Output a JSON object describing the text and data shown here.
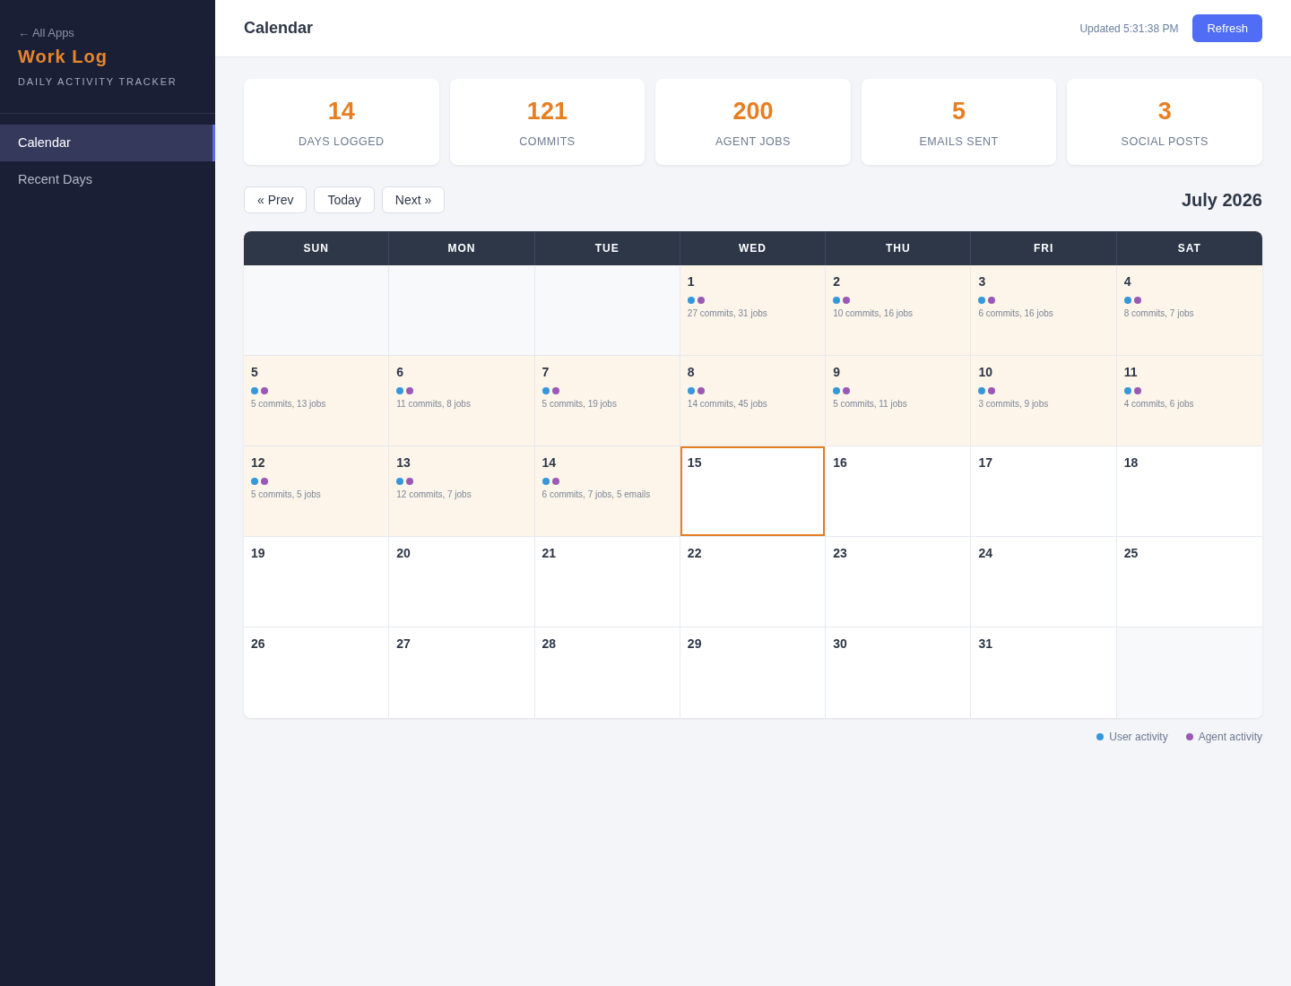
{
  "sidebar": {
    "back_link": "← All Apps",
    "title": "Work Log",
    "subtitle": "DAILY ACTIVITY TRACKER",
    "items": [
      {
        "label": "Calendar",
        "selected": true
      },
      {
        "label": "Recent Days",
        "selected": false
      }
    ]
  },
  "header": {
    "title": "Calendar",
    "updated": "Updated 5:31:38 PM",
    "button": "Refresh"
  },
  "stats": [
    {
      "value": "14",
      "label": "DAYS LOGGED"
    },
    {
      "value": "121",
      "label": "COMMITS"
    },
    {
      "value": "200",
      "label": "AGENT JOBS"
    },
    {
      "value": "5",
      "label": "EMAILS SENT"
    },
    {
      "value": "3",
      "label": "SOCIAL POSTS"
    }
  ],
  "calendar_nav": {
    "buttons": [
      "« Prev",
      "Today",
      "Next »"
    ],
    "month": "July 2026"
  },
  "calendar": {
    "weekdays": [
      "SUN",
      "MON",
      "TUE",
      "WED",
      "THU",
      "FRI",
      "SAT"
    ],
    "cells": [
      {
        "kind": "blank"
      },
      {
        "kind": "blank"
      },
      {
        "kind": "blank"
      },
      {
        "kind": "day",
        "day": "1",
        "logged": true,
        "today": false,
        "dots": [
          {
            "color": "#3498db"
          },
          {
            "color": "#9b59b6"
          }
        ],
        "summary": "27 commits, 31 jobs"
      },
      {
        "kind": "day",
        "day": "2",
        "logged": true,
        "today": false,
        "dots": [
          {
            "color": "#3498db"
          },
          {
            "color": "#9b59b6"
          }
        ],
        "summary": "10 commits, 16 jobs"
      },
      {
        "kind": "day",
        "day": "3",
        "logged": true,
        "today": false,
        "dots": [
          {
            "color": "#3498db"
          },
          {
            "color": "#9b59b6"
          }
        ],
        "summary": "6 commits, 16 jobs"
      },
      {
        "kind": "day",
        "day": "4",
        "logged": true,
        "today": false,
        "dots": [
          {
            "color": "#3498db"
          },
          {
            "color": "#9b59b6"
          }
        ],
        "summary": "8 commits, 7 jobs"
      },
      {
        "kind": "day",
        "day": "5",
        "logged": true,
        "today": false,
        "dots": [
          {
            "color": "#3498db"
          },
          {
            "color": "#9b59b6"
          }
        ],
        "summary": "5 commits, 13 jobs"
      },
      {
        "kind": "day",
        "day": "6",
        "logged": true,
        "today": false,
        "dots": [
          {
            "color": "#3498db"
          },
          {
            "color": "#9b59b6"
          }
        ],
        "summary": "11 commits, 8 jobs"
      },
      {
        "kind": "day",
        "day": "7",
        "logged": true,
        "today": false,
        "dots": [
          {
            "color": "#3498db"
          },
          {
            "color": "#9b59b6"
          }
        ],
        "summary": "5 commits, 19 jobs"
      },
      {
        "kind": "day",
        "day": "8",
        "logged": true,
        "today": false,
        "dots": [
          {
            "color": "#3498db"
          },
          {
            "color": "#9b59b6"
          }
        ],
        "summary": "14 commits, 45 jobs"
      },
      {
        "kind": "day",
        "day": "9",
        "logged": true,
        "today": false,
        "dots": [
          {
            "color": "#3498db"
          },
          {
            "color": "#9b59b6"
          }
        ],
        "summary": "5 commits, 11 jobs"
      },
      {
        "kind": "day",
        "day": "10",
        "logged": true,
        "today": false,
        "dots": [
          {
            "color": "#3498db"
          },
          {
            "color": "#9b59b6"
          }
        ],
        "summary": "3 commits, 9 jobs"
      },
      {
        "kind": "day",
        "day": "11",
        "logged": true,
        "today": false,
        "dots": [
          {
            "color": "#3498db"
          },
          {
            "color": "#9b59b6"
          }
        ],
        "summary": "4 commits, 6 jobs"
      },
      {
        "kind": "day",
        "day": "12",
        "logged": true,
        "today": false,
        "dots": [
          {
            "color": "#3498db"
          },
          {
            "color": "#9b59b6"
          }
        ],
        "summary": "5 commits, 5 jobs"
      },
      {
        "kind": "day",
        "day": "13",
        "logged": true,
        "today": false,
        "dots": [
          {
            "color": "#3498db"
          },
          {
            "color": "#9b59b6"
          }
        ],
        "summary": "12 commits, 7 jobs"
      },
      {
        "kind": "day",
        "day": "14",
        "logged": true,
        "today": false,
        "dots": [
          {
            "color": "#3498db"
          },
          {
            "color": "#9b59b6"
          }
        ],
        "summary": "6 commits, 7 jobs, 5 emails"
      },
      {
        "kind": "day",
        "day": "15",
        "logged": false,
        "today": true
      },
      {
        "kind": "day",
        "day": "16",
        "logged": false,
        "today": false
      },
      {
        "kind": "day",
        "day": "17",
        "logged": false,
        "today": false
      },
      {
        "kind": "day",
        "day": "18",
        "logged": false,
        "today": false
      },
      {
        "kind": "day",
        "day": "19",
        "logged": false,
        "today": false
      },
      {
        "kind": "day",
        "day": "20",
        "logged": false,
        "today": false
      },
      {
        "kind": "day",
        "day": "21",
        "logged": false,
        "today": false
      },
      {
        "kind": "day",
        "day": "22",
        "logged": false,
        "today": false
      },
      {
        "kind": "day",
        "day": "23",
        "logged": false,
        "today": false
      },
      {
        "kind": "day",
        "day": "24",
        "logged": false,
        "today": false
      },
      {
        "kind": "day",
        "day": "25",
        "logged": false,
        "today": false
      },
      {
        "kind": "day",
        "day": "26",
        "logged": false,
        "today": false
      },
      {
        "kind": "day",
        "day": "27",
        "logged": false,
        "today": false
      },
      {
        "kind": "day",
        "day": "28",
        "logged": false,
        "today": false
      },
      {
        "kind": "day",
        "day": "29",
        "logged": false,
        "today": false
      },
      {
        "kind": "day",
        "day": "30",
        "logged": false,
        "today": false
      },
      {
        "kind": "day",
        "day": "31",
        "logged": false,
        "today": false
      },
      {
        "kind": "blank"
      }
    ]
  },
  "legend": [
    {
      "label": "User activity",
      "color": "#3498db"
    },
    {
      "label": "Agent activity",
      "color": "#9b59b6"
    }
  ]
}
